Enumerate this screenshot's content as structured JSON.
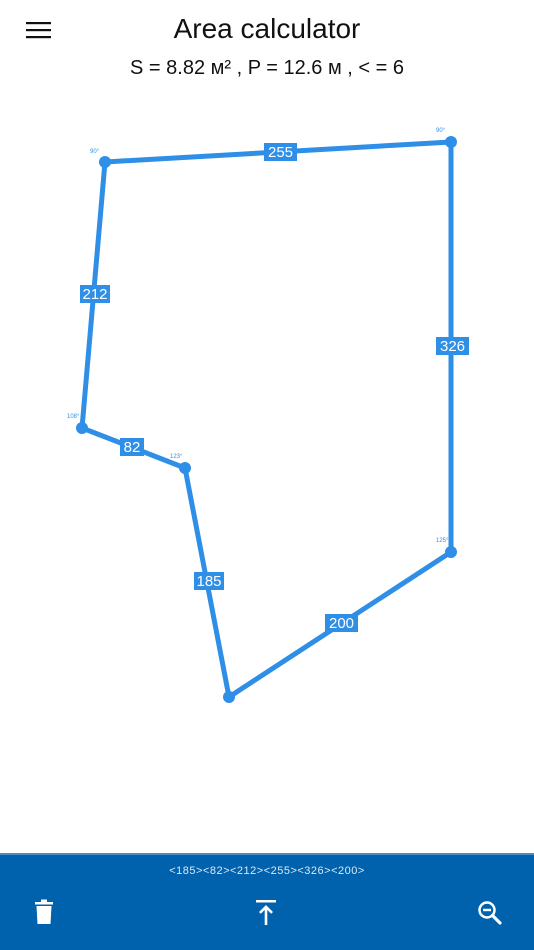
{
  "header": {
    "title": "Area calculator",
    "stats": "S = 8.82 м² , P = 12.6 м , < = 6"
  },
  "polygon": {
    "vertices": [
      {
        "angle": "90°"
      },
      {
        "angle": "90°"
      },
      {
        "angle": "125°"
      },
      {
        "angle": ""
      },
      {
        "angle": "123°"
      },
      {
        "angle": "108°"
      }
    ],
    "edges": [
      {
        "length": "255"
      },
      {
        "length": "326"
      },
      {
        "length": "200"
      },
      {
        "length": "185"
      },
      {
        "length": "82"
      },
      {
        "length": "212"
      }
    ]
  },
  "bottom_bar": {
    "sequence": "<185><82><212><255><326><200>"
  },
  "colors": {
    "accent": "#2f8fe6",
    "bar": "#0062ad"
  },
  "icons": {
    "menu": "menu-icon",
    "delete": "trash-icon",
    "export": "upload-icon",
    "zoom": "zoom-out-icon"
  }
}
